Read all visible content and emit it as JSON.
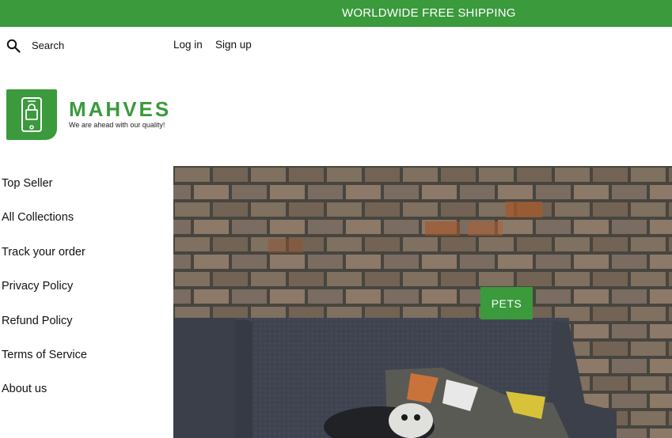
{
  "announcement": {
    "text": "WORLDWIDE FREE SHIPPING"
  },
  "header": {
    "search_label": "Search",
    "login_label": "Log in",
    "signup_label": "Sign up"
  },
  "logo": {
    "name": "MAHVES",
    "tagline": "We are ahead with our quality!"
  },
  "menu": {
    "items": [
      {
        "label": "Top Seller"
      },
      {
        "label": "All Collections"
      },
      {
        "label": "Track your order"
      },
      {
        "label": "Privacy Policy"
      },
      {
        "label": "Refund Policy"
      },
      {
        "label": "Terms of Service"
      },
      {
        "label": "About us"
      }
    ]
  },
  "hero": {
    "cta_label": "PETS"
  },
  "colors": {
    "brand_green": "#3a9a3c",
    "text": "#111111",
    "background": "#ffffff"
  }
}
